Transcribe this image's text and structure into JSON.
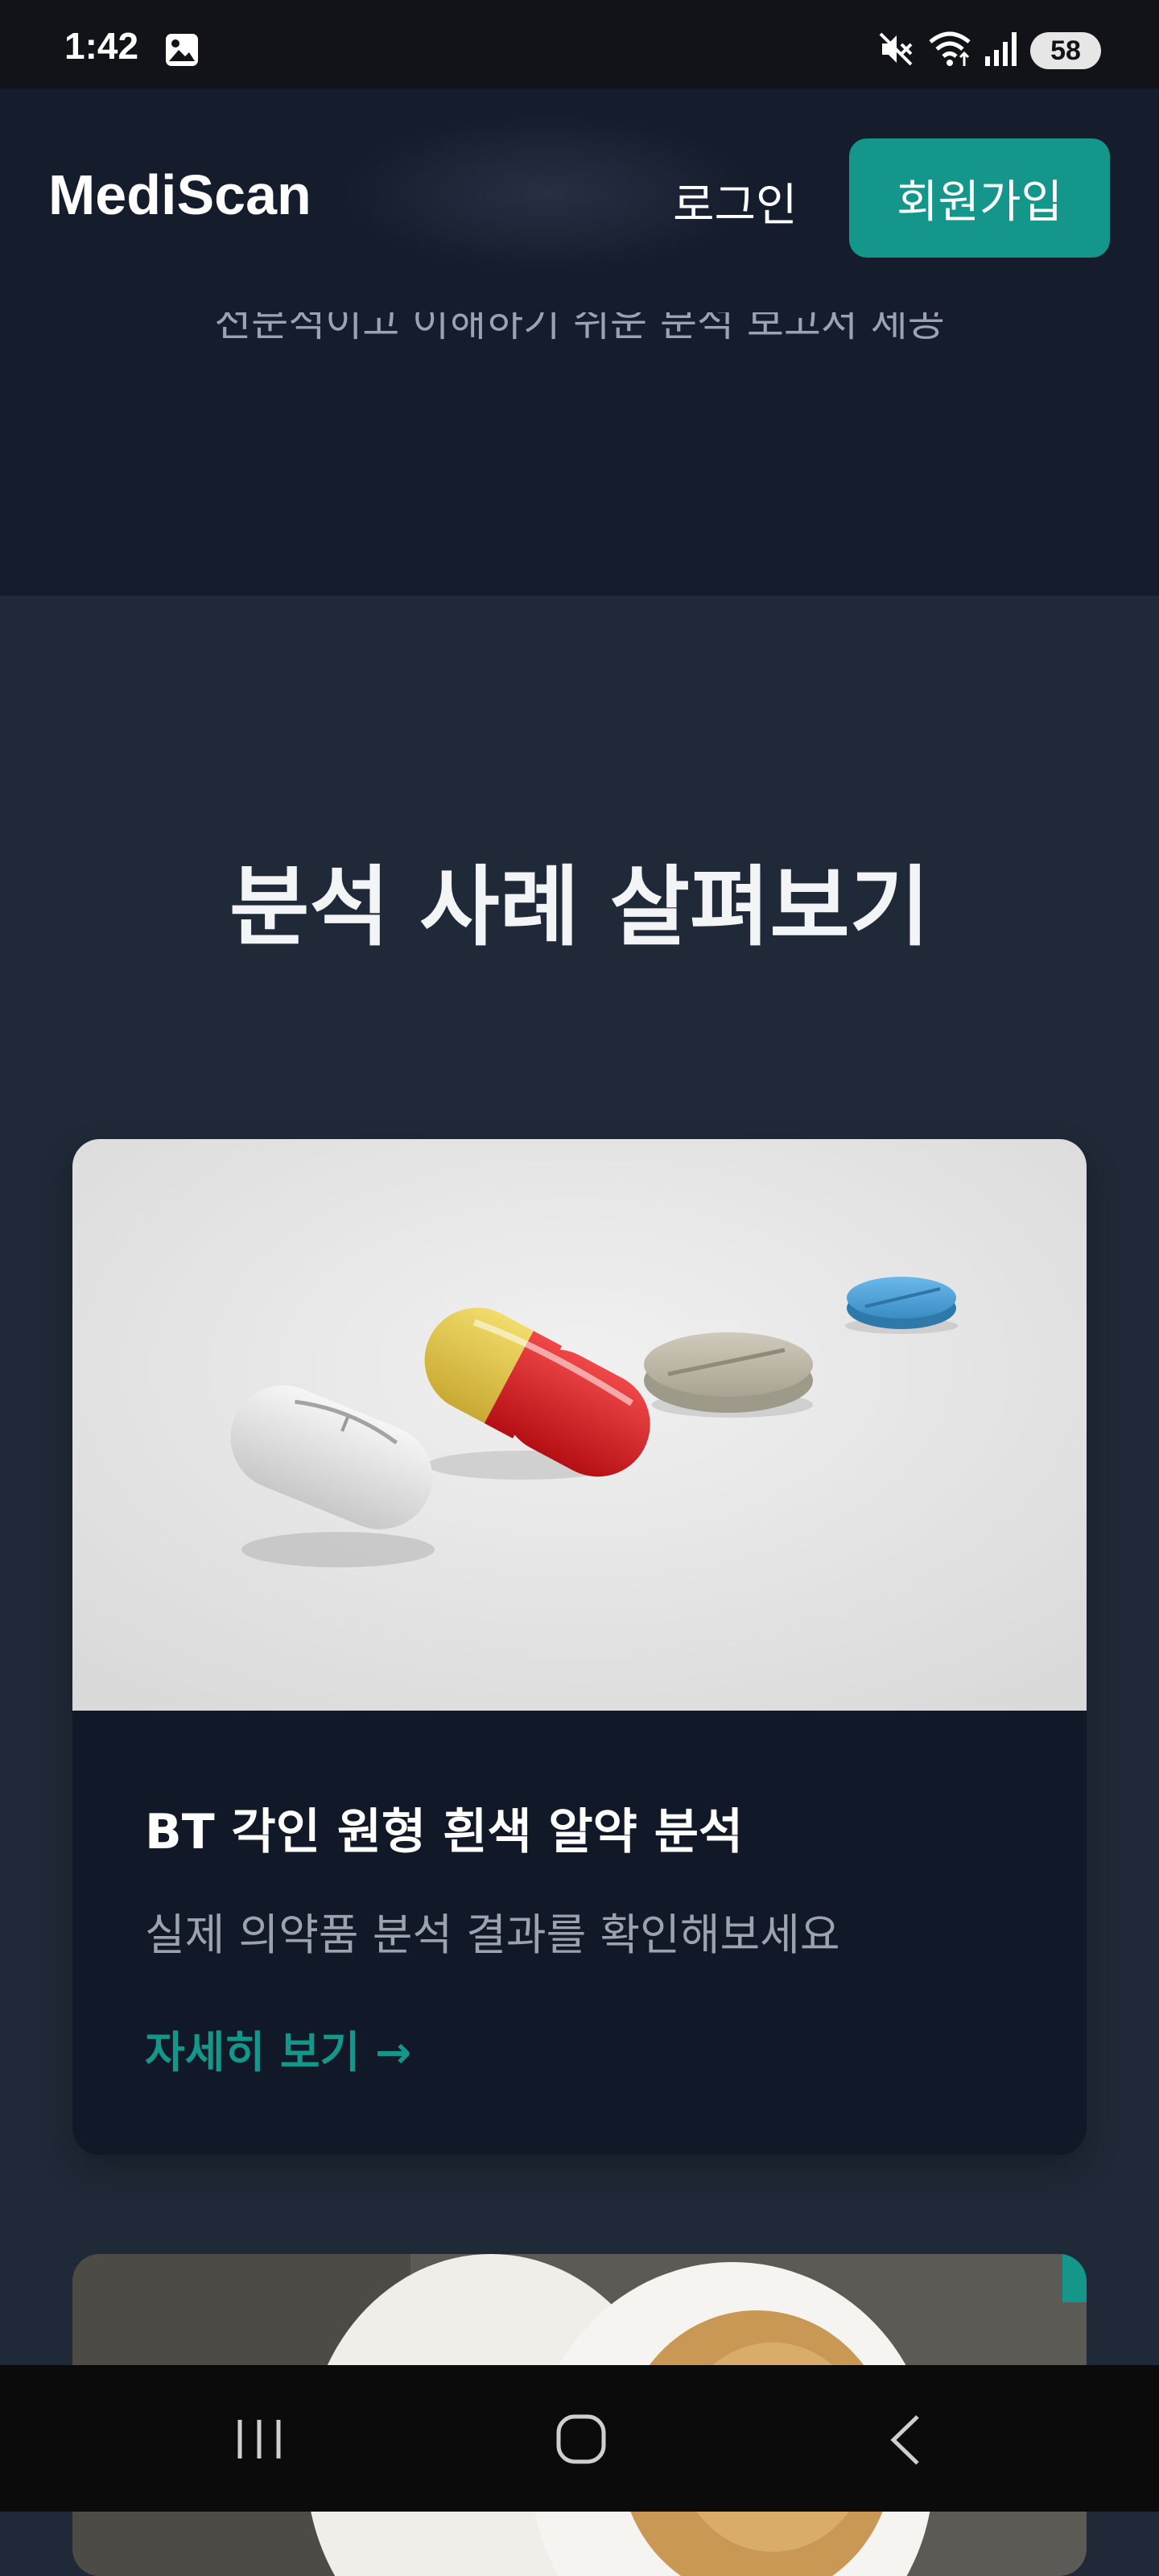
{
  "status_bar": {
    "time": "1:42",
    "battery": "58",
    "icons": [
      "gallery-icon",
      "mute-icon",
      "wifi-icon",
      "signal-icon"
    ]
  },
  "header": {
    "brand": "MediScan",
    "login_label": "로그인",
    "signup_label": "회원가입",
    "accent_color": "#14968a"
  },
  "hero": {
    "subtitle": "전문적이고 이해하기 쉬운 분석 보고서 제공"
  },
  "examples": {
    "title": "분석 사례 살펴보기",
    "cards": [
      {
        "title": "BT 각인 원형 흰색 알약 분석",
        "description": "실제 의약품 분석 결과를 확인해보세요",
        "link_label": "자세히 보기 →"
      }
    ]
  },
  "nav": {
    "icons": [
      "recent-apps-icon",
      "home-icon",
      "back-icon"
    ]
  }
}
